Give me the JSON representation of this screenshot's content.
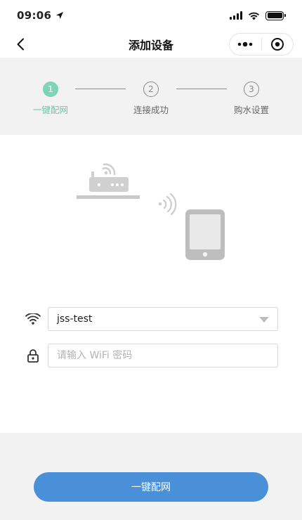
{
  "status_bar": {
    "time": "09:06"
  },
  "nav": {
    "title": "添加设备"
  },
  "steps": [
    {
      "number": "1",
      "label": "一键配网",
      "active": true
    },
    {
      "number": "2",
      "label": "连接成功",
      "active": false
    },
    {
      "number": "3",
      "label": "购水设置",
      "active": false
    }
  ],
  "form": {
    "ssid_value": "jss-test",
    "password_placeholder": "请输入 WiFi 密码"
  },
  "primary_button": {
    "label": "一键配网"
  },
  "colors": {
    "accent": "#7fd3b6",
    "primary": "#4a90d9",
    "panel_bg": "#f2f2f2"
  }
}
